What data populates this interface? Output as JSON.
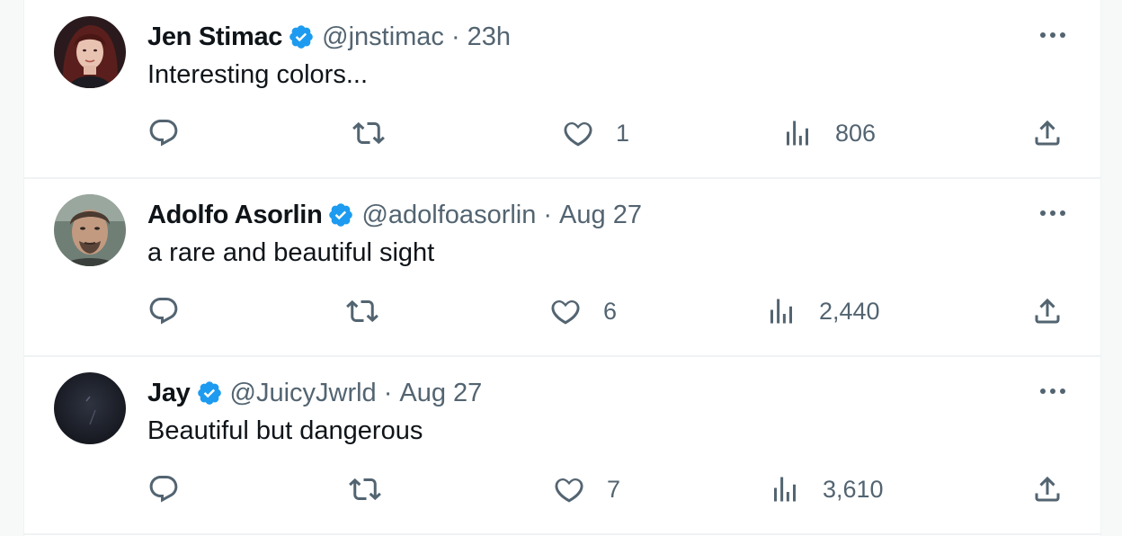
{
  "tweets": [
    {
      "name": "Jen Stimac",
      "handle": "@jnstimac",
      "separator": "·",
      "time": "23h",
      "text": "Interesting colors...",
      "likes": "1",
      "views": "806",
      "avatar": "woman-portrait"
    },
    {
      "name": "Adolfo Asorlin",
      "handle": "@adolfoasorlin",
      "separator": "·",
      "time": "Aug 27",
      "text": "a rare and beautiful sight",
      "likes": "6",
      "views": "2,440",
      "avatar": "man-portrait"
    },
    {
      "name": "Jay",
      "handle": "@JuicyJwrld",
      "separator": "·",
      "time": "Aug 27",
      "text": "Beautiful but dangerous",
      "likes": "7",
      "views": "3,610",
      "avatar": "dark-abstract"
    }
  ],
  "icons": {
    "verified": "verified-badge-icon",
    "reply": "reply-icon",
    "retweet": "retweet-icon",
    "like": "heart-icon",
    "views": "views-chart-icon",
    "share": "share-icon",
    "more": "more-dots-icon"
  },
  "colors": {
    "verified": "#1d9bf0",
    "secondary_text": "#536471",
    "primary_text": "#0f1419",
    "divider": "#eff3f4"
  }
}
